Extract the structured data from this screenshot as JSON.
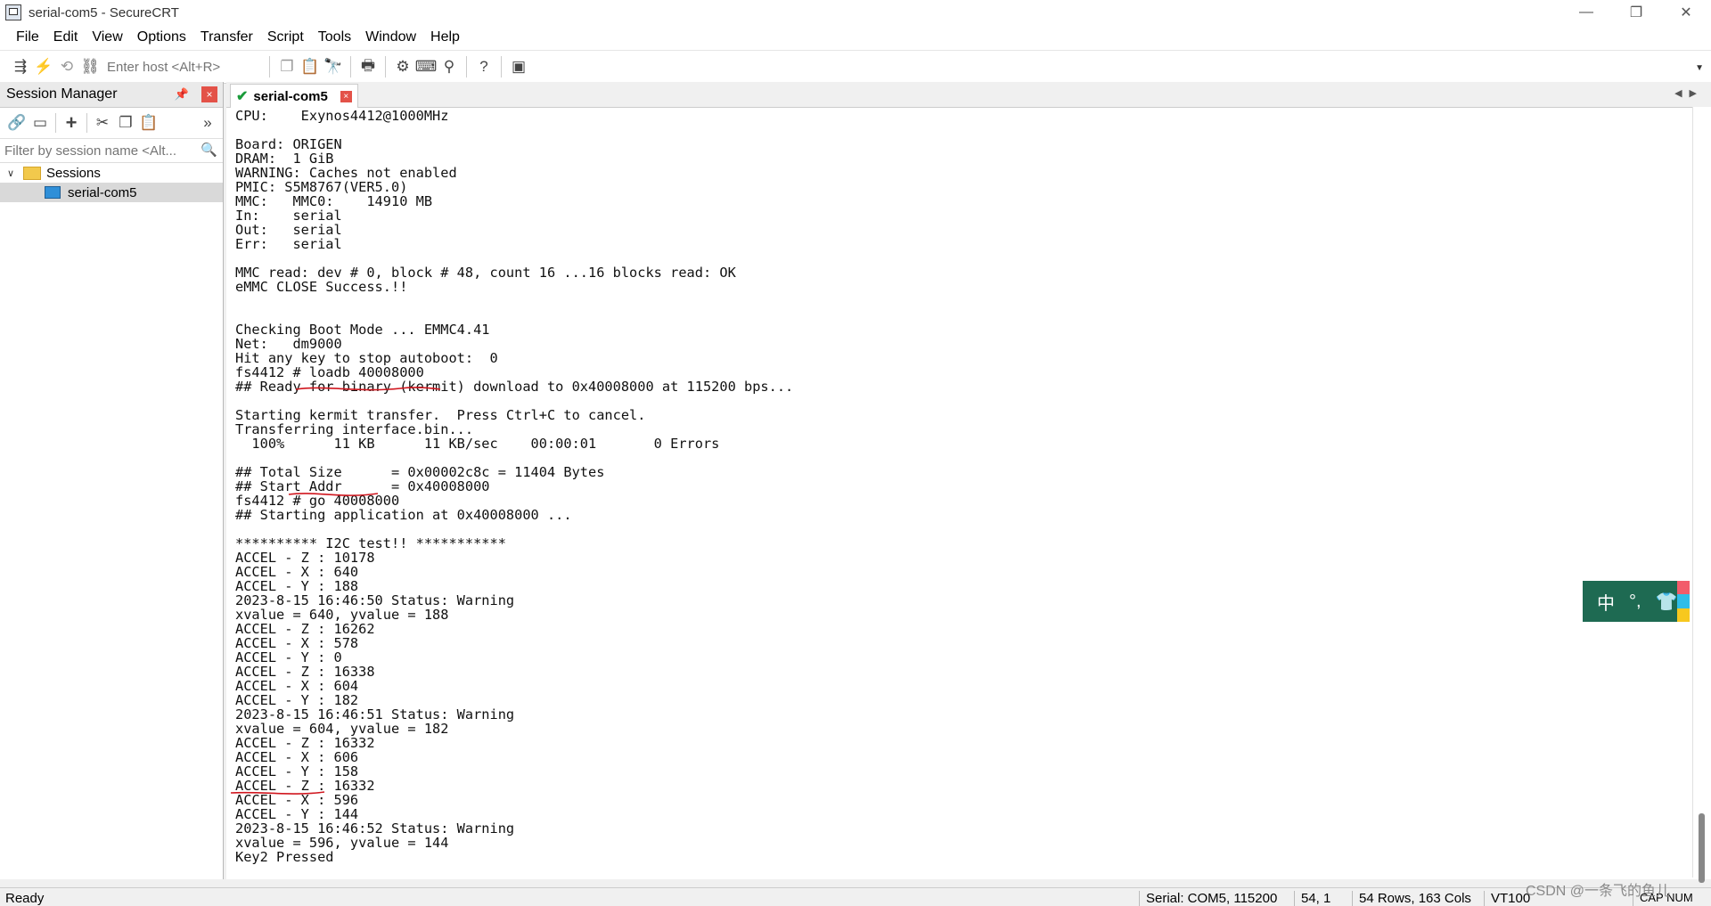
{
  "window": {
    "title": "serial-com5 - SecureCRT",
    "controls": [
      "—",
      "❐",
      "✕"
    ]
  },
  "menu": [
    "File",
    "Edit",
    "View",
    "Options",
    "Transfer",
    "Script",
    "Tools",
    "Window",
    "Help"
  ],
  "toolbar": {
    "host_placeholder": "Enter host <Alt+R>"
  },
  "session_manager": {
    "title": "Session Manager",
    "filter_placeholder": "Filter by session name <Alt...",
    "tree": [
      {
        "label": "Sessions",
        "type": "folder",
        "expanded": true
      },
      {
        "label": "serial-com5",
        "type": "session",
        "selected": true
      }
    ]
  },
  "tab": {
    "label": "serial-com5",
    "connected": true
  },
  "terminal": [
    "CPU:    Exynos4412@1000MHz",
    "",
    "Board: ORIGEN",
    "DRAM:  1 GiB",
    "WARNING: Caches not enabled",
    "PMIC: S5M8767(VER5.0)",
    "MMC:   MMC0:    14910 MB",
    "In:    serial",
    "Out:   serial",
    "Err:   serial",
    "",
    "MMC read: dev # 0, block # 48, count 16 ...16 blocks read: OK",
    "eMMC CLOSE Success.!!",
    "",
    "",
    "Checking Boot Mode ... EMMC4.41",
    "Net:   dm9000",
    "Hit any key to stop autoboot:  0",
    "fs4412 # loadb 40008000",
    "## Ready for binary (kermit) download to 0x40008000 at 115200 bps...",
    "",
    "Starting kermit transfer.  Press Ctrl+C to cancel.",
    "Transferring interface.bin...",
    "  100%      11 KB      11 KB/sec    00:00:01       0 Errors",
    "",
    "## Total Size      = 0x00002c8c = 11404 Bytes",
    "## Start Addr      = 0x40008000",
    "fs4412 # go 40008000",
    "## Starting application at 0x40008000 ...",
    "",
    "********** I2C test!! ***********",
    "ACCEL - Z : 10178",
    "ACCEL - X : 640",
    "ACCEL - Y : 188",
    "2023-8-15 16:46:50 Status: Warning",
    "xvalue = 640, yvalue = 188",
    "ACCEL - Z : 16262",
    "ACCEL - X : 578",
    "ACCEL - Y : 0",
    "ACCEL - Z : 16338",
    "ACCEL - X : 604",
    "ACCEL - Y : 182",
    "2023-8-15 16:46:51 Status: Warning",
    "xvalue = 604, yvalue = 182",
    "ACCEL - Z : 16332",
    "ACCEL - X : 606",
    "ACCEL - Y : 158",
    "ACCEL - Z : 16332",
    "ACCEL - X : 596",
    "ACCEL - Y : 144",
    "2023-8-15 16:46:52 Status: Warning",
    "xvalue = 596, yvalue = 144",
    "Key2 Pressed"
  ],
  "ime": {
    "lang": "中",
    "punct": "°,",
    "skin_icon": "shirt-icon"
  },
  "status": {
    "left": "Ready",
    "connection": "Serial: COM5, 115200",
    "cursor": "54,  1",
    "size": "54 Rows, 163 Cols",
    "terminal_type": "VT100",
    "keys": "CAP NUM"
  },
  "watermark": "CSDN @一条飞的鱼儿",
  "colors": {
    "close_red": "#e35248",
    "ime_green": "#1e6a52",
    "annotation_red": "#d0161e"
  }
}
